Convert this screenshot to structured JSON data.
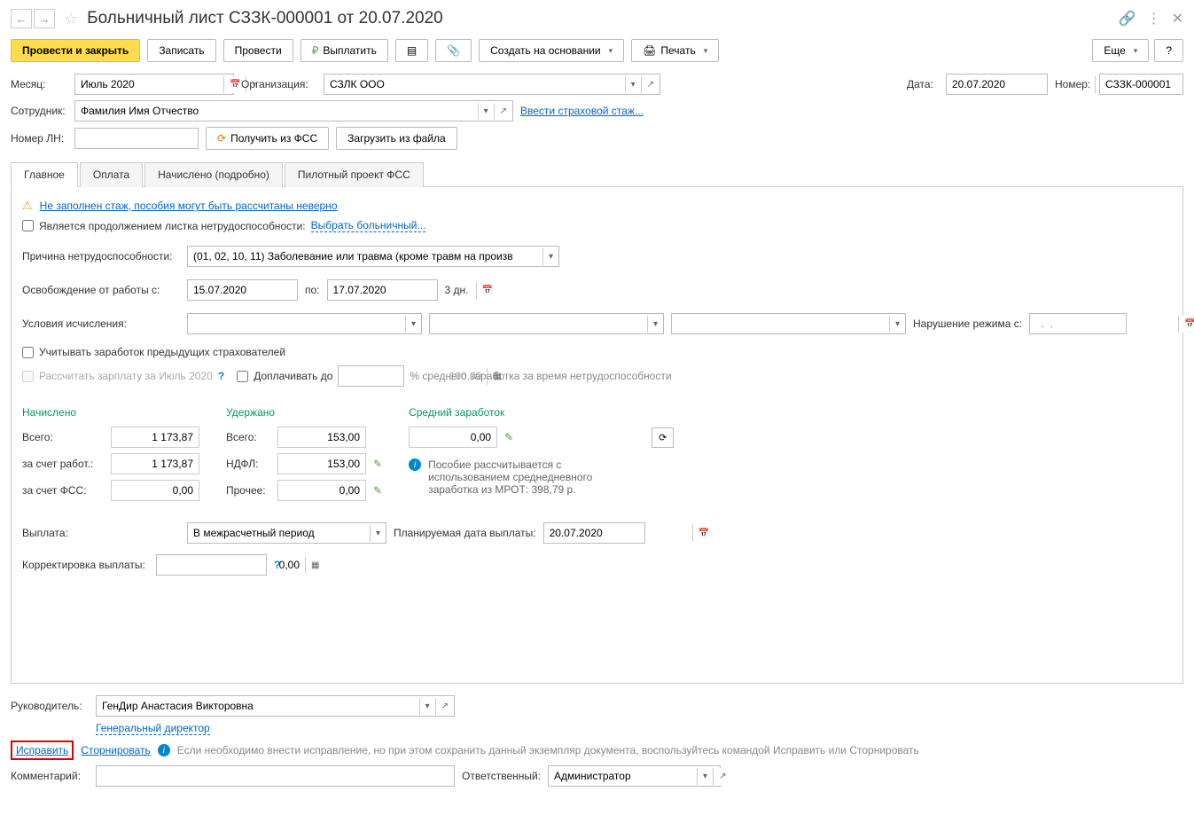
{
  "header": {
    "title": "Больничный лист СЗЗК-000001 от 20.07.2020"
  },
  "toolbar": {
    "post_close": "Провести и закрыть",
    "save": "Записать",
    "post": "Провести",
    "pay": "Выплатить",
    "create_based": "Создать на основании",
    "print": "Печать",
    "more": "Еще",
    "help": "?"
  },
  "fields": {
    "month_label": "Месяц:",
    "month_value": "Июль 2020",
    "org_label": "Организация:",
    "org_value": "СЗЛК ООО",
    "date_label": "Дата:",
    "date_value": "20.07.2020",
    "number_label": "Номер:",
    "number_value": "СЗЗК-000001",
    "employee_label": "Сотрудник:",
    "employee_value": "Фамилия Имя Отчество",
    "enter_seniority": "Ввести страховой стаж...",
    "ln_label": "Номер ЛН:",
    "get_from_fss": "Получить из ФСС",
    "load_from_file": "Загрузить из файла"
  },
  "tabs": [
    "Главное",
    "Оплата",
    "Начислено (подробно)",
    "Пилотный проект ФСС"
  ],
  "main_tab": {
    "warning": "Не заполнен стаж, пособия могут быть рассчитаны неверно",
    "continuation_label": "Является продолжением листка нетрудоспособности:",
    "select_ln": "Выбрать больничный...",
    "reason_label": "Причина нетрудоспособности:",
    "reason_value": "(01, 02, 10, 11) Заболевание или травма (кроме травм на произв",
    "release_label": "Освобождение от работы с:",
    "date_from": "15.07.2020",
    "to_label": "по:",
    "date_to": "17.07.2020",
    "days": "3 дн.",
    "conditions_label": "Условия исчисления:",
    "violation_label": "Нарушение режима с:",
    "violation_placeholder": "  .  .    ",
    "prev_employers": "Учитывать заработок предыдущих страхователей",
    "calc_salary": "Рассчитать зарплату за Июль 2020",
    "topup_label": "Доплачивать до",
    "topup_value": "100,00",
    "topup_hint": "% среднего заработка за время нетрудоспособности"
  },
  "totals": {
    "accrued_title": "Начислено",
    "withheld_title": "Удержано",
    "avg_title": "Средний заработок",
    "total_label": "Всего:",
    "accrued_total": "1 173,87",
    "employer_label": "за счет работ.:",
    "accrued_employer": "1 173,87",
    "fss_label": "за счет ФСС:",
    "accrued_fss": "0,00",
    "withheld_total": "153,00",
    "ndfl_label": "НДФЛ:",
    "withheld_ndfl": "153,00",
    "other_label": "Прочее:",
    "withheld_other": "0,00",
    "avg_value": "0,00",
    "info_text": "Пособие рассчитывается с использованием среднедневного заработка из МРОТ: 398,79 р."
  },
  "payment": {
    "label": "Выплата:",
    "value": "В межрасчетный период",
    "planned_label": "Планируемая дата выплаты:",
    "planned_value": "20.07.2020",
    "correction_label": "Корректировка выплаты:",
    "correction_value": "0,00"
  },
  "footer": {
    "manager_label": "Руководитель:",
    "manager_value": "ГенДир Анастасия Викторовна",
    "manager_position": "Генеральный директор",
    "correct": "Исправить",
    "reverse": "Сторнировать",
    "hint": "Если необходимо внести исправление, но при этом сохранить данный экземпляр документа, воспользуйтесь командой Исправить или Сторнировать",
    "comment_label": "Комментарий:",
    "responsible_label": "Ответственный:",
    "responsible_value": "Администратор"
  }
}
